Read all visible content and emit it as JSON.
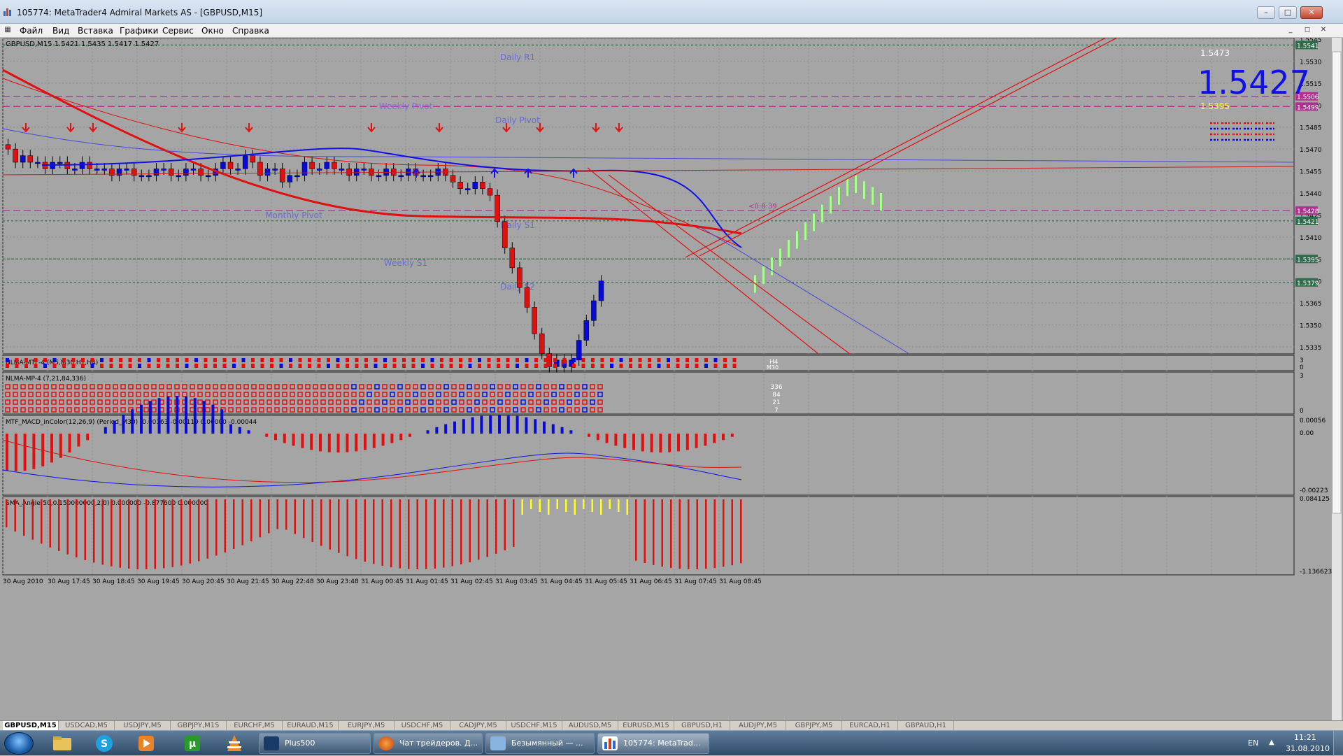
{
  "window": {
    "title": "105774: MetaTrader4 Admiral Markets AS - [GBPUSD,M15]",
    "minimize": "–",
    "maximize": "□",
    "close": "✕"
  },
  "menu": [
    "Файл",
    "Вид",
    "Вставка",
    "Графики",
    "Сервис",
    "Окно",
    "Справка"
  ],
  "mdi": {
    "minimize": "_",
    "restore": "◻",
    "close": "✕"
  },
  "chart": {
    "header": "GBPUSD,M15  1.5421 1.5435 1.5417 1.5427",
    "big_price": "1.5427",
    "ask": "1.5473",
    "bid": "1.5395",
    "countdown": "<0:8:39",
    "levels": [
      {
        "label": "Daily R1",
        "color": "#6a6ad8"
      },
      {
        "label": "Weekly Pivot",
        "color": "#8a6ad8"
      },
      {
        "label": "Daily Pivot",
        "color": "#6a6ad8"
      },
      {
        "label": "Monthly Pivot",
        "color": "#6a6ad8"
      },
      {
        "label": "Daily S1",
        "color": "#6a6ad8"
      },
      {
        "label": "Weekly S1",
        "color": "#6a6ad8"
      },
      {
        "label": "Daily S2",
        "color": "#6a6ad8"
      }
    ],
    "price_scale": [
      "1.5545",
      "1.5530",
      "1.5515",
      "1.5500",
      "1.5485",
      "1.5470",
      "1.5455",
      "1.5440",
      "1.5425",
      "1.5410",
      "1.5395",
      "1.5380",
      "1.5365",
      "1.5350",
      "1.5335"
    ],
    "price_tags": [
      {
        "value": "1.5541",
        "color": "#2e6b4a"
      },
      {
        "value": "1.5506",
        "color": "#b03090"
      },
      {
        "value": "1.5499",
        "color": "#b03090"
      },
      {
        "value": "1.5428",
        "color": "#b03090"
      },
      {
        "value": "1.5421",
        "color": "#2e6b4a"
      },
      {
        "value": "1.5395",
        "color": "#2e6b4a"
      },
      {
        "value": "1.5379",
        "color": "#2e6b4a"
      }
    ],
    "time_axis": [
      "30 Aug 2010",
      "30 Aug 17:45",
      "30 Aug 18:45",
      "30 Aug 19:45",
      "30 Aug 20:45",
      "30 Aug 21:45",
      "30 Aug 22:48",
      "30 Aug 23:48",
      "31 Aug 00:45",
      "31 Aug 01:45",
      "31 Aug 02:45",
      "31 Aug 03:45",
      "31 Aug 04:45",
      "31 Aug 05:45",
      "31 Aug 06:45",
      "31 Aug 07:45",
      "31 Aug 08:45"
    ]
  },
  "indicators": {
    "mtf_label": "NLMA-MTF-4 (M5,M30,H1,H4)",
    "mtf_scale": [
      "3",
      "0"
    ],
    "mtf_tag": "H4",
    "mtf_tag2": "M30",
    "mp_label": "NLMA-MP-4 (7,21,84,336)",
    "mp_scale": [
      "3",
      "0"
    ],
    "mp_values": [
      "336",
      "84",
      "21",
      "7"
    ],
    "macd_label": "MTF_MACD_inColor(12,26,9) (Period_M30) -0.00163 -0.00119 0.00000 -0.00044",
    "macd_scale": [
      "0.00056",
      "0.00",
      "-0.00223"
    ],
    "sma_label": "SMA_Angle(50,0.150000000,2,0) 0.000000 -0.877600 0.000000",
    "sma_scale": [
      "0.084125",
      "-1.136623"
    ]
  },
  "symbol_tabs": [
    "GBPUSD,M15",
    "USDCAD,M5",
    "USDJPY,M5",
    "GBPJPY,M15",
    "EURCHF,M5",
    "EURAUD,M15",
    "EURJPY,M5",
    "USDCHF,M5",
    "CADJPY,M5",
    "USDCHF,M15",
    "AUDUSD,M5",
    "EURUSD,M15",
    "GBPUSD,H1",
    "AUDJPY,M5",
    "GBPJPY,M5",
    "EURCAD,H1",
    "GBPAUD,H1"
  ],
  "taskbar": {
    "tasks": [
      "Plus500",
      "Чат трейдеров. Д...",
      "Безымянный — ...",
      "105774: MetaTrad..."
    ],
    "lang": "EN",
    "time": "11:21",
    "date": "31.08.2010"
  },
  "colors": {
    "chart_bg": "#a5a5a5",
    "bull": "#0a0ad8",
    "bear": "#e01010",
    "future": "#a8ff90",
    "price_big": "#1010e8"
  }
}
